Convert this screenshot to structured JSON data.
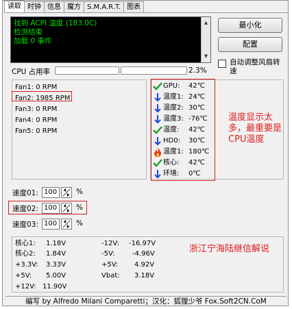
{
  "tabs": [
    "读取",
    "时钟",
    "信息",
    "魔方",
    "S.M.A.R.T.",
    "图表"
  ],
  "log": [
    "找到 ACPI 温度 (183.0C)",
    "检测结束",
    "加载 0 事件"
  ],
  "buttons": {
    "minimize": "最小化",
    "config": "配置"
  },
  "auto_fan_label": "自动调整风扇转速",
  "cpu": {
    "label": "CPU 占用率",
    "value": "2.3%",
    "usage_percent": 2.3
  },
  "fans": [
    "Fan1: 0 RPM",
    "Fan2: 1985 RPM",
    "Fan3: 0 RPM",
    "Fan4: 0 RPM",
    "Fan5: 0 RPM"
  ],
  "temps": [
    {
      "icon": "check-icon",
      "name": "GPU:",
      "value": "42℃"
    },
    {
      "icon": "arrow-down-icon",
      "name": "温度1:",
      "value": "24℃"
    },
    {
      "icon": "arrow-down-icon",
      "name": "温度2:",
      "value": "30℃"
    },
    {
      "icon": "arrow-down-icon",
      "name": "温度3:",
      "value": "-76℃"
    },
    {
      "icon": "check-icon",
      "name": "温度:",
      "value": "42℃"
    },
    {
      "icon": "arrow-down-icon",
      "name": "HD0:",
      "value": "30℃"
    },
    {
      "icon": "flame-icon",
      "name": "温度1:",
      "value": "180℃"
    },
    {
      "icon": "check-icon",
      "name": "核心:",
      "value": "42℃"
    },
    {
      "icon": "arrow-down-icon",
      "name": "环境:",
      "value": "0℃"
    }
  ],
  "speeds": [
    {
      "label": "速度01:",
      "value": "100",
      "unit": "%"
    },
    {
      "label": "速度02:",
      "value": "100",
      "unit": "%"
    },
    {
      "label": "速度03:",
      "value": "100",
      "unit": "%"
    }
  ],
  "voltages": [
    {
      "name": "核心1:",
      "value": "1.18V"
    },
    {
      "name": "核心2:",
      "value": "1.84V"
    },
    {
      "name": "+3.3V:",
      "value": "3.33V"
    },
    {
      "name": "+5V:",
      "value": "5.00V"
    },
    {
      "name": "+12V:",
      "value": "11.90V"
    },
    {
      "name": "-12V:",
      "value": "-16.97V"
    },
    {
      "name": "-5V:",
      "value": "-4.96V"
    },
    {
      "name": "+5V:",
      "value": "4.92V"
    },
    {
      "name": "Vbat:",
      "value": "3.18V"
    }
  ],
  "notes": {
    "temperature": "温度显示太多，最重要是CPU温度",
    "author": "浙江宁海陆继信解说"
  },
  "footer": "编写 by Alfredo Milani Comparetti；汉化：狐狸少爷 Fox.Soft2CN.CoM",
  "colors": {
    "log_bg": "#000000",
    "log_text": "#00d800",
    "highlight": "#d02020",
    "note_text": "#e02020"
  }
}
